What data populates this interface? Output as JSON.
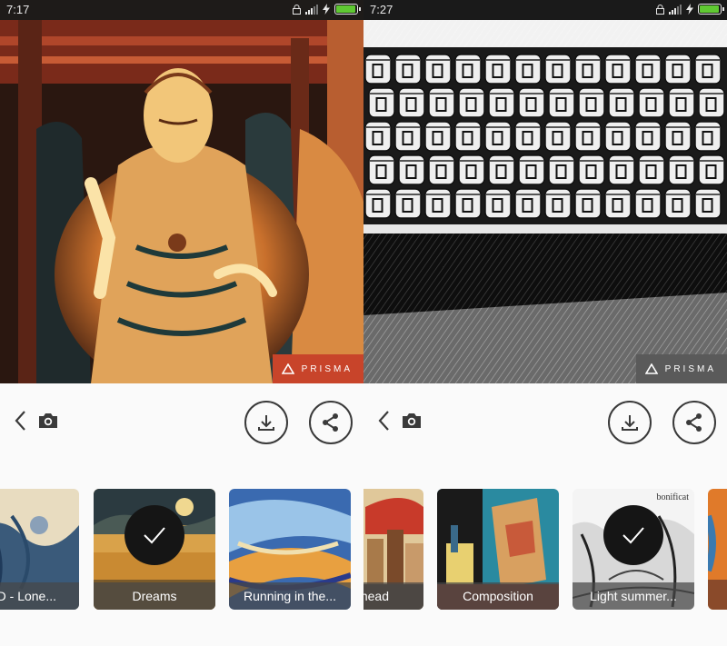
{
  "screens": [
    {
      "status": {
        "time": "7:17"
      },
      "watermark": "PRISMA",
      "filters": [
        {
          "label": "us D - Lone..."
        },
        {
          "label": "Dreams",
          "selected": true
        },
        {
          "label": "Running in the..."
        }
      ]
    },
    {
      "status": {
        "time": "7:27"
      },
      "watermark": "PRISMA",
      "filters": [
        {
          "label": "head"
        },
        {
          "label": "Composition"
        },
        {
          "label": "Light summer...",
          "selected": true,
          "caption": "bonificat"
        },
        {
          "label": ""
        }
      ]
    }
  ],
  "icons": {
    "back": "chevron-left-icon",
    "camera": "camera-icon",
    "download": "download-icon",
    "share": "share-icon",
    "check": "check-icon",
    "logo": "triangle-logo-icon"
  },
  "colors": {
    "battery": "#5fc832",
    "watermark_left": "#c8442a",
    "watermark_right": "#5a5a5a",
    "button_border": "#3a3a3a",
    "background": "#fafafa"
  }
}
